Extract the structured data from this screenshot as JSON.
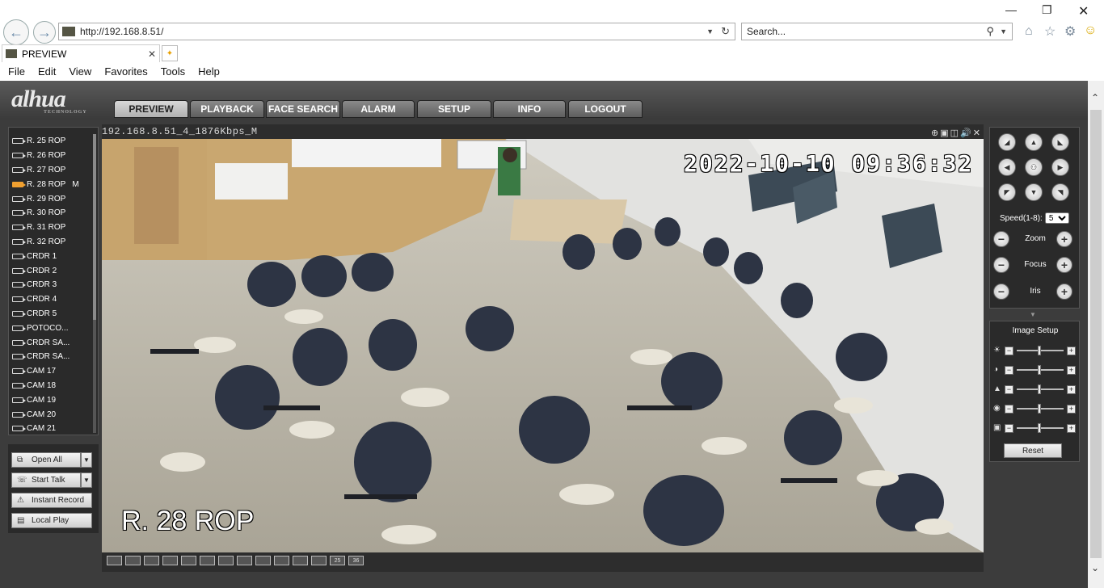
{
  "browser": {
    "url": "http://192.168.8.51/",
    "search_placeholder": "Search...",
    "tab_title": "PREVIEW",
    "menu": [
      "File",
      "Edit",
      "View",
      "Favorites",
      "Tools",
      "Help"
    ]
  },
  "app": {
    "logo": "alhua",
    "logo_sub": "TECHNOLOGY",
    "tabs": [
      "PREVIEW",
      "PLAYBACK",
      "FACE SEARCH",
      "ALARM",
      "SETUP",
      "INFO",
      "LOGOUT"
    ],
    "active_tab": "PREVIEW"
  },
  "cameras": [
    {
      "label": "R. 25 ROP",
      "active": false,
      "flag": ""
    },
    {
      "label": "R. 26 ROP",
      "active": false,
      "flag": ""
    },
    {
      "label": "R. 27 ROP",
      "active": false,
      "flag": ""
    },
    {
      "label": "R. 28 ROP",
      "active": true,
      "flag": "M"
    },
    {
      "label": "R. 29 ROP",
      "active": false,
      "flag": ""
    },
    {
      "label": "R. 30 ROP",
      "active": false,
      "flag": ""
    },
    {
      "label": "R. 31 ROP",
      "active": false,
      "flag": ""
    },
    {
      "label": "R. 32 ROP",
      "active": false,
      "flag": ""
    },
    {
      "label": "CRDR 1",
      "active": false,
      "flag": ""
    },
    {
      "label": "CRDR 2",
      "active": false,
      "flag": ""
    },
    {
      "label": "CRDR 3",
      "active": false,
      "flag": ""
    },
    {
      "label": "CRDR 4",
      "active": false,
      "flag": ""
    },
    {
      "label": "CRDR 5",
      "active": false,
      "flag": ""
    },
    {
      "label": "POTOCO...",
      "active": false,
      "flag": ""
    },
    {
      "label": "CRDR SA...",
      "active": false,
      "flag": ""
    },
    {
      "label": "CRDR SA...",
      "active": false,
      "flag": ""
    },
    {
      "label": "CAM 17",
      "active": false,
      "flag": ""
    },
    {
      "label": "CAM 18",
      "active": false,
      "flag": ""
    },
    {
      "label": "CAM 19",
      "active": false,
      "flag": ""
    },
    {
      "label": "CAM 20",
      "active": false,
      "flag": ""
    },
    {
      "label": "CAM 21",
      "active": false,
      "flag": ""
    }
  ],
  "left_buttons": {
    "open_all": "Open All",
    "start_talk": "Start Talk",
    "instant_record": "Instant Record",
    "local_play": "Local Play"
  },
  "video": {
    "stream_title": "192.168.8.51_4_1876Kbps_M",
    "timestamp": "2022-10-10 09:36:32",
    "channel_overlay": "R. 28 ROP",
    "layouts": [
      "1",
      "2",
      "3",
      "4",
      "5",
      "6",
      "7",
      "8",
      "9",
      "10",
      "11",
      "12",
      "25",
      "36"
    ]
  },
  "ptz": {
    "speed_label": "Speed(1-8):",
    "speed_value": "5",
    "zoom_label": "Zoom",
    "focus_label": "Focus",
    "iris_label": "Iris"
  },
  "image_setup": {
    "title": "Image Setup",
    "reset_label": "Reset",
    "sliders": [
      {
        "icon": "brightness-icon",
        "level": 0.45
      },
      {
        "icon": "contrast-icon",
        "level": 0.45
      },
      {
        "icon": "saturation-icon",
        "level": 0.45
      },
      {
        "icon": "hue-icon",
        "level": 0.45
      },
      {
        "icon": "sharpness-icon",
        "level": 0.45
      }
    ]
  }
}
